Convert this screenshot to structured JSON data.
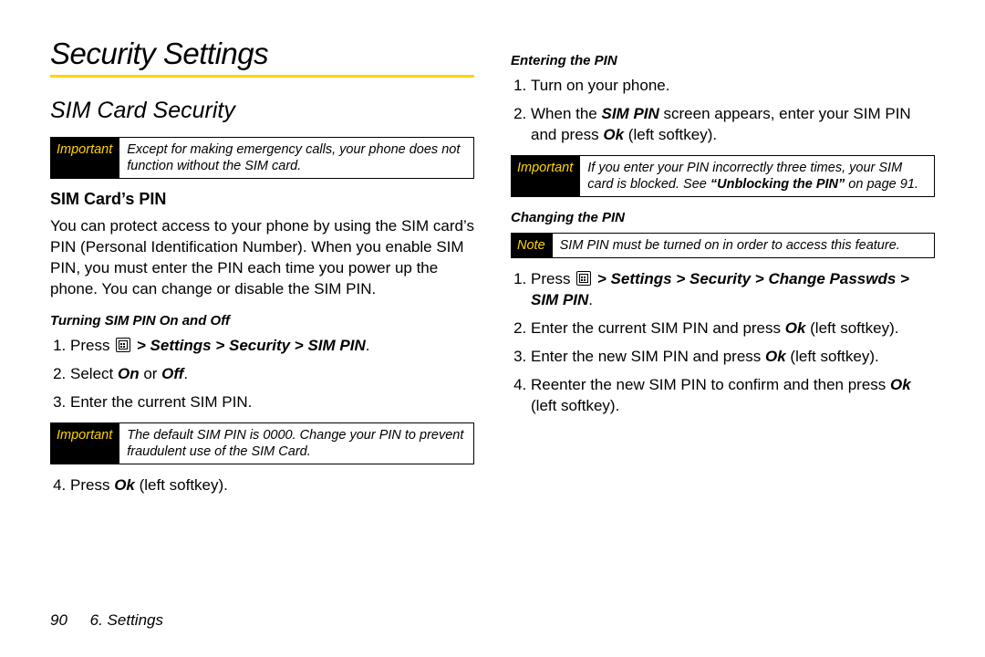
{
  "page": {
    "number": "90",
    "section": "6. Settings"
  },
  "left": {
    "title": "Security Settings",
    "h2": "SIM Card Security",
    "callout1": {
      "tag": "Important",
      "text": "Except for making emergency calls, your phone does not function without the SIM card."
    },
    "h3": "SIM Card’s PIN",
    "body": "You can protect access to your phone by using the SIM card’s PIN (Personal Identification Number). When you enable SIM PIN, you must enter the PIN each time you power up the phone. You can change or disable the SIM PIN.",
    "h4": "Turning SIM PIN On and Off",
    "step1_pre": "Press ",
    "step1_path": " > Settings > Security > SIM PIN",
    "step1_post": ".",
    "step2_pre": "Select ",
    "step2_on": "On",
    "step2_or": " or ",
    "step2_off": "Off",
    "step2_post": ".",
    "step3": "Enter the current SIM PIN.",
    "callout2": {
      "tag": "Important",
      "text": "The default SIM PIN is 0000. Change your PIN to prevent fraudulent use of the SIM Card."
    },
    "step4_pre": "Press ",
    "step4_ok": "Ok",
    "step4_post": " (left softkey)."
  },
  "right": {
    "h4a": "Entering the PIN",
    "a_step1": "Turn on your phone.",
    "a_step2_pre": "When the ",
    "a_step2_sim": "SIM PIN",
    "a_step2_mid": " screen appears, enter your SIM PIN and press ",
    "a_step2_ok": "Ok",
    "a_step2_post": " (left softkey).",
    "callout3": {
      "tag": "Important",
      "text_pre": "If you enter your PIN incorrectly three times, your SIM card is blocked. See ",
      "text_bold": "“Unblocking the PIN”",
      "text_post": " on page 91."
    },
    "h4b": "Changing the PIN",
    "callout4": {
      "tag": "Note",
      "text": "SIM PIN must be turned on in order to access this feature."
    },
    "b_step1_pre": "Press ",
    "b_step1_path": " > Settings > Security > Change Passwds > SIM PIN",
    "b_step1_post": ".",
    "b_step2_pre": "Enter the current SIM PIN and press ",
    "b_step2_ok": "Ok",
    "b_step2_post": " (left softkey).",
    "b_step3_pre": "Enter the new SIM PIN and press ",
    "b_step3_ok": "Ok",
    "b_step3_post": " (left softkey).",
    "b_step4_pre": "Reenter the new SIM PIN to confirm and then press ",
    "b_step4_ok": "Ok",
    "b_step4_post": " (left softkey)."
  }
}
